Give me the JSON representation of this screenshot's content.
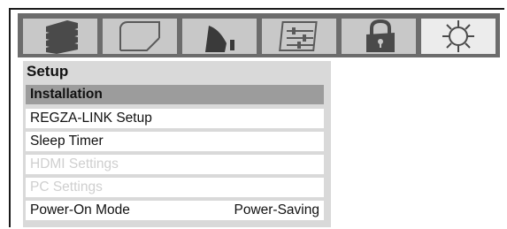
{
  "tabs": [
    {
      "icon": "picture-settings-icon"
    },
    {
      "icon": "screen-size-icon"
    },
    {
      "icon": "audio-icon"
    },
    {
      "icon": "preferences-icon"
    },
    {
      "icon": "lock-icon"
    },
    {
      "icon": "setup-gear-icon",
      "selected": true
    }
  ],
  "menu": {
    "title": "Setup",
    "items": [
      {
        "label": "Installation",
        "value": "",
        "state": "selected"
      },
      {
        "label": "REGZA-LINK Setup",
        "value": "",
        "state": "normal"
      },
      {
        "label": "Sleep Timer",
        "value": "",
        "state": "normal"
      },
      {
        "label": "HDMI Settings",
        "value": "",
        "state": "disabled"
      },
      {
        "label": "PC Settings",
        "value": "",
        "state": "disabled"
      },
      {
        "label": "Power-On Mode",
        "value": "Power-Saving",
        "state": "normal"
      }
    ]
  },
  "colors": {
    "icon_bar": "#6c6c6c",
    "tab": "#c8c8c8",
    "tab_active": "#ececec",
    "panel": "#d9d9d9",
    "selected_row": "#9c9c9c",
    "disabled_text": "#cfcfcf"
  }
}
